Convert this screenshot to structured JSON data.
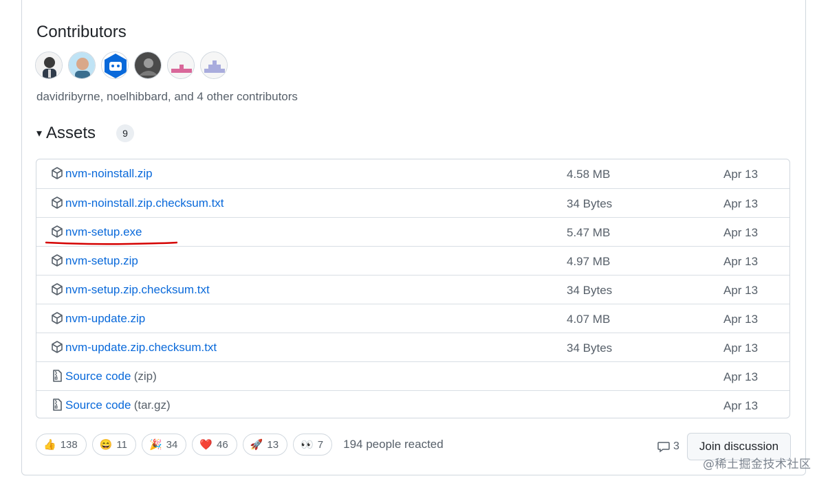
{
  "contributors": {
    "title": "Contributors",
    "avatars": [
      "davidribyrne",
      "noelhibbard",
      "bot",
      "contributor-4",
      "contributor-5",
      "contributor-6"
    ],
    "summary": "davidribyrne, noelhibbard, and 4 other contributors"
  },
  "assets": {
    "caret": "▾",
    "title": "Assets",
    "count": "9",
    "rows": [
      {
        "name": "nvm-noinstall.zip",
        "sub": "",
        "size": "4.58 MB",
        "date": "Apr 13",
        "icon": "package-icon"
      },
      {
        "name": "nvm-noinstall.zip.checksum.txt",
        "sub": "",
        "size": "34 Bytes",
        "date": "Apr 13",
        "icon": "package-icon"
      },
      {
        "name": "nvm-setup.exe",
        "sub": "",
        "size": "5.47 MB",
        "date": "Apr 13",
        "icon": "package-icon"
      },
      {
        "name": "nvm-setup.zip",
        "sub": "",
        "size": "4.97 MB",
        "date": "Apr 13",
        "icon": "package-icon"
      },
      {
        "name": "nvm-setup.zip.checksum.txt",
        "sub": "",
        "size": "34 Bytes",
        "date": "Apr 13",
        "icon": "package-icon"
      },
      {
        "name": "nvm-update.zip",
        "sub": "",
        "size": "4.07 MB",
        "date": "Apr 13",
        "icon": "package-icon"
      },
      {
        "name": "nvm-update.zip.checksum.txt",
        "sub": "",
        "size": "34 Bytes",
        "date": "Apr 13",
        "icon": "package-icon"
      },
      {
        "name": "Source code",
        "sub": " (zip)",
        "size": "",
        "date": "Apr 13",
        "icon": "file-zip-icon"
      },
      {
        "name": "Source code",
        "sub": " (tar.gz)",
        "size": "",
        "date": "Apr 13",
        "icon": "file-zip-icon"
      }
    ]
  },
  "reactions": {
    "items": [
      {
        "emoji": "👍",
        "count": "138",
        "icon": "thumbs-up-icon"
      },
      {
        "emoji": "😄",
        "count": "11",
        "icon": "laugh-icon"
      },
      {
        "emoji": "🎉",
        "count": "34",
        "icon": "hooray-icon"
      },
      {
        "emoji": "❤️",
        "count": "46",
        "icon": "heart-icon"
      },
      {
        "emoji": "🚀",
        "count": "13",
        "icon": "rocket-icon"
      },
      {
        "emoji": "👀",
        "count": "7",
        "icon": "eyes-icon"
      }
    ],
    "summary": "194 people reacted"
  },
  "discussion": {
    "comment_count": "3",
    "join_label": "Join discussion"
  },
  "watermark": "@稀土掘金技术社区",
  "colors": {
    "link": "#0969da",
    "muted": "#57606a",
    "border": "#d0d7de",
    "annotation": "#d40000"
  }
}
